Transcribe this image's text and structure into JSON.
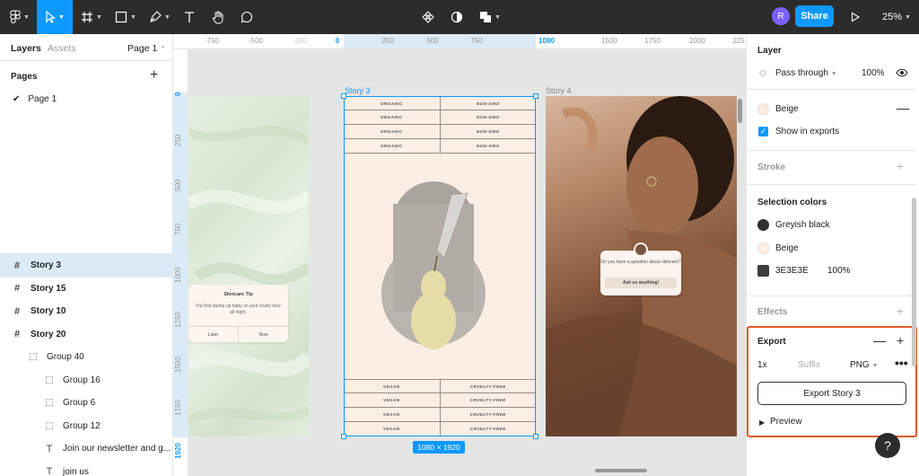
{
  "toolbar": {
    "avatar_initial": "R",
    "share_label": "Share",
    "zoom_label": "25%"
  },
  "left_panel": {
    "tab_layers": "Layers",
    "tab_assets": "Assets",
    "page_selector": "Page 1",
    "pages_heading": "Pages",
    "current_page": "Page 1",
    "layers": [
      {
        "name": "Story 3",
        "type": "frame",
        "selected": true,
        "indent": 0
      },
      {
        "name": "Story 15",
        "type": "frame",
        "selected": false,
        "indent": 0
      },
      {
        "name": "Story 10",
        "type": "frame",
        "selected": false,
        "indent": 0
      },
      {
        "name": "Story 20",
        "type": "frame",
        "selected": false,
        "indent": 0
      },
      {
        "name": "Group 40",
        "type": "group",
        "selected": false,
        "indent": 1
      },
      {
        "name": "Group 16",
        "type": "group",
        "selected": false,
        "indent": 2
      },
      {
        "name": "Group 6",
        "type": "group",
        "selected": false,
        "indent": 2
      },
      {
        "name": "Group 12",
        "type": "group",
        "selected": false,
        "indent": 2
      },
      {
        "name": "Join our newsletter and g...",
        "type": "text",
        "selected": false,
        "indent": 2
      },
      {
        "name": "join us",
        "type": "text",
        "selected": false,
        "indent": 2
      }
    ]
  },
  "rulers": {
    "top": [
      "-750",
      "-500",
      "-250",
      "0",
      "250",
      "500",
      "750",
      "1080",
      "1500",
      "1750",
      "2000",
      "225"
    ],
    "left": [
      "0",
      "250",
      "500",
      "750",
      "1000",
      "1250",
      "1500",
      "1750",
      "1920"
    ]
  },
  "canvas": {
    "story3_label": "Story 3",
    "story4_label": "Story 4",
    "dimensions_badge": "1080 × 1920",
    "tip_card": {
      "title": "Skincare Tip",
      "body": "Put that plump up baby on your lovely face all night.",
      "btn_later": "Later",
      "btn_now": "Now"
    },
    "top_tags": [
      [
        "ORGANIC",
        "NON-GMO"
      ],
      [
        "ORGANIC",
        "NON-GMO"
      ],
      [
        "ORGANIC",
        "NON-GMO"
      ],
      [
        "ORGANIC",
        "NON-GMO"
      ]
    ],
    "bottom_tags": [
      [
        "VEGAN",
        "CRUELTY-FREE"
      ],
      [
        "VEGAN",
        "CRUELTY-FREE"
      ],
      [
        "VEGAN",
        "CRUELTY-FREE"
      ],
      [
        "VEGAN",
        "CRUELTY-FREE"
      ]
    ],
    "question_card": {
      "text": "Do you have a question about skincare?",
      "button": "Ask us anything!"
    }
  },
  "right_panel": {
    "layer_title": "Layer",
    "blend_mode": "Pass through",
    "opacity": "100%",
    "fill_name": "Beige",
    "show_in_exports": "Show in exports",
    "stroke_title": "Stroke",
    "selection_colors_title": "Selection colors",
    "colors": [
      {
        "name": "Greyish black",
        "hex": "#2f2f2f"
      },
      {
        "name": "Beige",
        "hex": "#fbeee4"
      }
    ],
    "hex_color": {
      "value": "3E3E3E",
      "opacity": "100%",
      "hex": "#3e3e3e"
    },
    "effects_title": "Effects",
    "export_title": "Export",
    "export_scale": "1x",
    "export_suffix_placeholder": "Suffix",
    "export_format": "PNG",
    "export_button": "Export Story 3",
    "preview_label": "Preview",
    "help_label": "?"
  }
}
